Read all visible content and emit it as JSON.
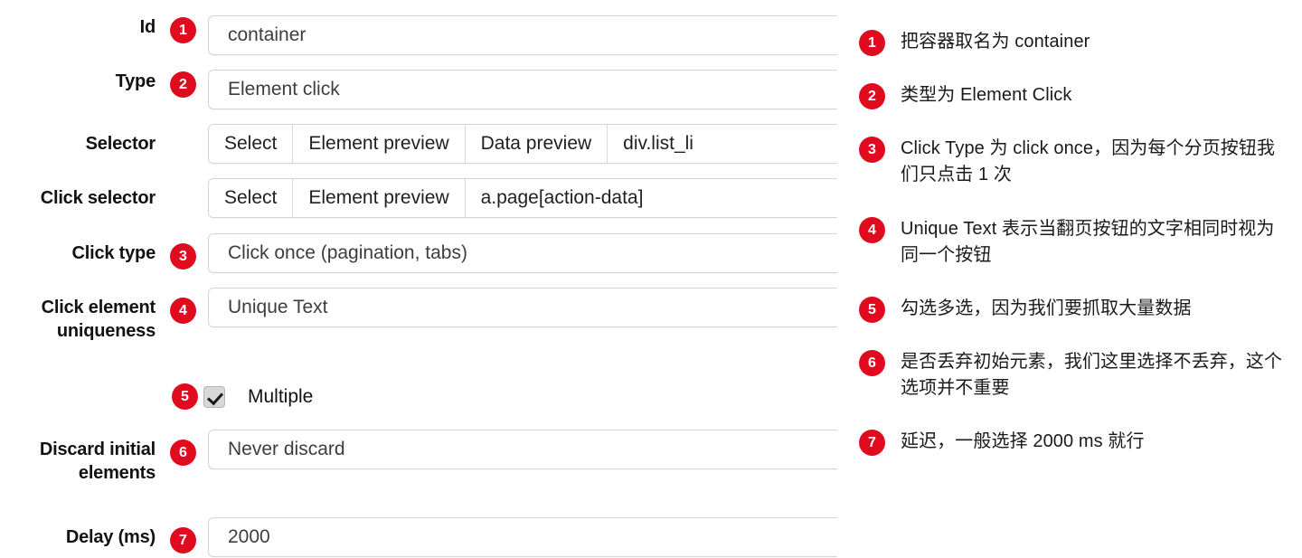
{
  "colors": {
    "badge_red": "#e00b1e",
    "text": "#1a1a1a",
    "field_border": "#d4d4d4"
  },
  "form": {
    "rows": [
      {
        "label": "Id",
        "badge": "1",
        "kind": "input",
        "value": "container"
      },
      {
        "label": "Type",
        "badge": "2",
        "kind": "input",
        "value": "Element click"
      },
      {
        "label": "Selector",
        "badge": "",
        "kind": "segmented",
        "buttons": [
          "Select",
          "Element preview",
          "Data preview"
        ],
        "value": "div.list_li"
      },
      {
        "label": "Click selector",
        "badge": "",
        "kind": "segmented",
        "buttons": [
          "Select",
          "Element preview"
        ],
        "value": "a.page[action-data]"
      },
      {
        "label": "Click type",
        "badge": "3",
        "kind": "input",
        "value": "Click once (pagination, tabs)"
      },
      {
        "label": "Click element uniqueness",
        "badge": "4",
        "kind": "input",
        "value": "Unique Text"
      },
      {
        "label": "Discard initial elements",
        "badge": "6",
        "kind": "input",
        "value": "Never discard"
      },
      {
        "label": "Delay (ms)",
        "badge": "7",
        "kind": "input",
        "value": "2000"
      }
    ],
    "checkbox": {
      "badge": "5",
      "label": "Multiple",
      "checked": true
    }
  },
  "notes": [
    {
      "badge": "1",
      "text": "把容器取名为 container"
    },
    {
      "badge": "2",
      "text": "类型为 Element Click"
    },
    {
      "badge": "3",
      "text": "Click Type 为 click once，因为每个分页按钮我们只点击 1 次"
    },
    {
      "badge": "4",
      "text": "Unique Text 表示当翻页按钮的文字相同时视为同一个按钮"
    },
    {
      "badge": "5",
      "text": "勾选多选，因为我们要抓取大量数据"
    },
    {
      "badge": "6",
      "text": "是否丢弃初始元素，我们这里选择不丢弃，这个选项并不重要"
    },
    {
      "badge": "7",
      "text": "延迟，一般选择 2000 ms 就行"
    }
  ]
}
